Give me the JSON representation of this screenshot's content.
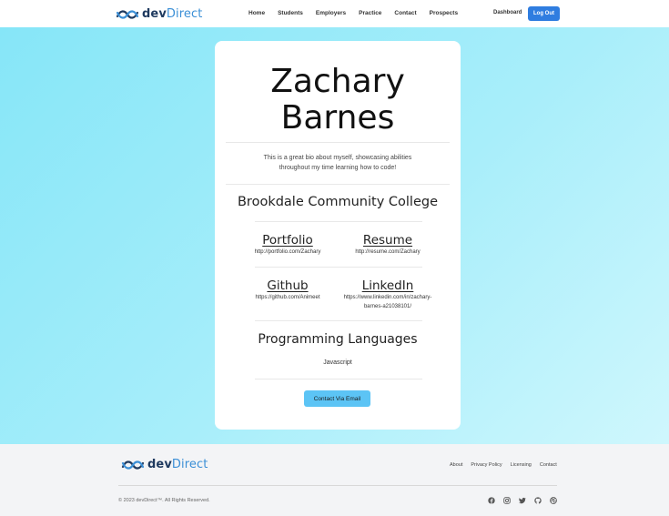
{
  "header": {
    "brand_dev": "dev",
    "brand_direct": "Direct",
    "nav": [
      "Home",
      "Students",
      "Employers",
      "Practice",
      "Contact",
      "Prospects"
    ],
    "dashboard_label": "Dashboard",
    "logout_label": "Log Out"
  },
  "profile": {
    "name_line1": "Zachary",
    "name_line2": "Barnes",
    "bio": "This is a great bio about myself, showcasing abilities throughout my time learning how to code!",
    "school": "Brookdale Community College",
    "links": {
      "portfolio": {
        "title": "Portfolio",
        "url": "http://portfolio.com/Zachary"
      },
      "resume": {
        "title": "Resume",
        "url": "http://resume.com/Zachary"
      },
      "github": {
        "title": "Github",
        "url": "https://github.com/Animeet"
      },
      "linkedin": {
        "title": "LinkedIn",
        "url_line1": "https://www.linkedin.com/in/zachary-",
        "url_line2": "barnes-a21038101/"
      }
    },
    "languages_heading": "Programming Languages",
    "languages": "Javascript",
    "contact_button": "Contact Via Email"
  },
  "footer": {
    "brand_dev": "dev",
    "brand_direct": "Direct",
    "links": [
      "About",
      "Privacy Policy",
      "Licensing",
      "Contact"
    ],
    "copyright": "© 2023 devDirect™. All Rights Reserved."
  },
  "colors": {
    "accent": "#2f7de0",
    "email_button": "#5cc4f5",
    "brand_dark": "#1f3a5f",
    "brand_light": "#3b8fd6"
  },
  "icons": [
    "logo-mark-icon",
    "facebook-icon",
    "instagram-icon",
    "twitter-icon",
    "github-icon",
    "dribbble-icon"
  ]
}
